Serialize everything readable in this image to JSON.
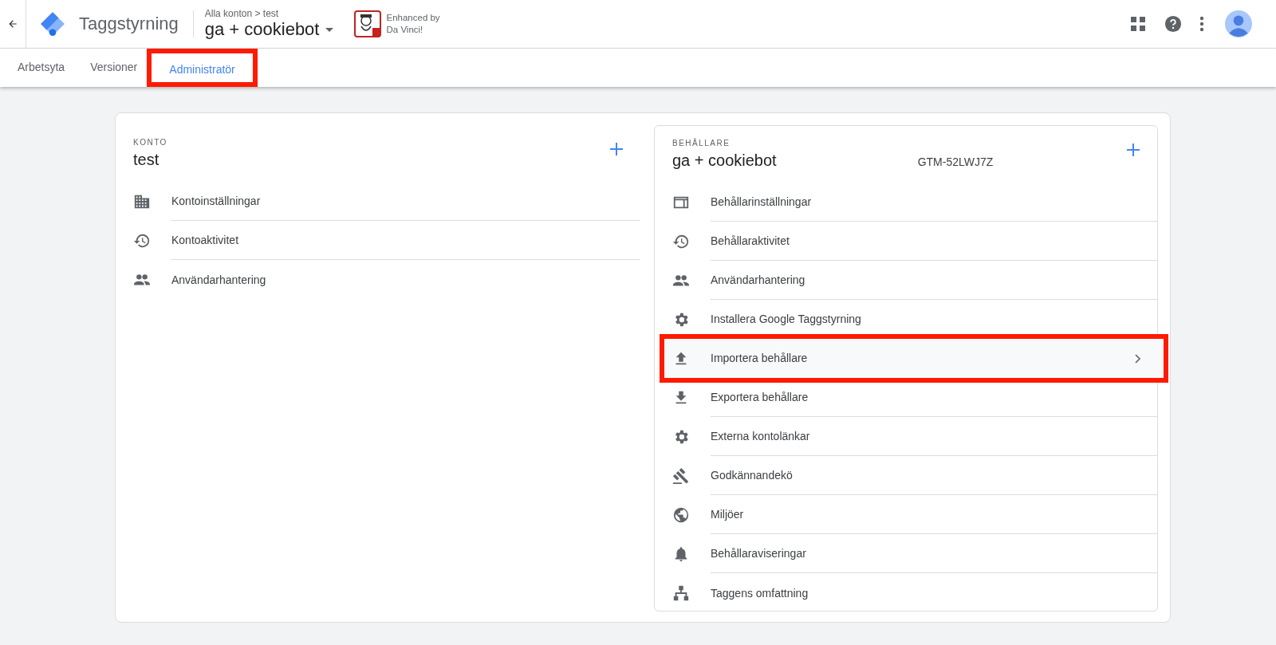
{
  "header": {
    "product": "Taggstyrning",
    "breadcrumb": "Alla konton > test",
    "container_name": "ga + cookiebot",
    "extension": {
      "line1": "Enhanced by",
      "line2": "Da Vinci!"
    }
  },
  "tabs": [
    {
      "label": "Arbetsyta",
      "selected": false,
      "highlighted": false
    },
    {
      "label": "Versioner",
      "selected": false,
      "highlighted": false
    },
    {
      "label": "Administratör",
      "selected": true,
      "highlighted": true
    }
  ],
  "account": {
    "section_label": "KONTO",
    "name": "test",
    "items": [
      {
        "kind": "building",
        "label": "Kontoinställningar",
        "highlighted": false
      },
      {
        "kind": "history",
        "label": "Kontoaktivitet",
        "highlighted": false
      },
      {
        "kind": "people",
        "label": "Användarhantering",
        "highlighted": false
      }
    ]
  },
  "container": {
    "section_label": "BEHÅLLARE",
    "name": "ga + cookiebot",
    "id": "GTM-52LWJ7Z",
    "items": [
      {
        "kind": "browser",
        "label": "Behållarinställningar",
        "highlighted": false
      },
      {
        "kind": "history",
        "label": "Behållaraktivitet",
        "highlighted": false
      },
      {
        "kind": "people",
        "label": "Användarhantering",
        "highlighted": false
      },
      {
        "kind": "gear",
        "label": "Installera Google Taggstyrning",
        "highlighted": false
      },
      {
        "kind": "upload",
        "label": "Importera behållare",
        "highlighted": true
      },
      {
        "kind": "download",
        "label": "Exportera behållare",
        "highlighted": false
      },
      {
        "kind": "gear",
        "label": "Externa kontolänkar",
        "highlighted": false
      },
      {
        "kind": "gavel",
        "label": "Godkännandekö",
        "highlighted": false
      },
      {
        "kind": "globe",
        "label": "Miljöer",
        "highlighted": false
      },
      {
        "kind": "bell",
        "label": "Behållaraviseringar",
        "highlighted": false
      },
      {
        "kind": "hierarchy",
        "label": "Taggens omfattning",
        "highlighted": false
      }
    ]
  }
}
